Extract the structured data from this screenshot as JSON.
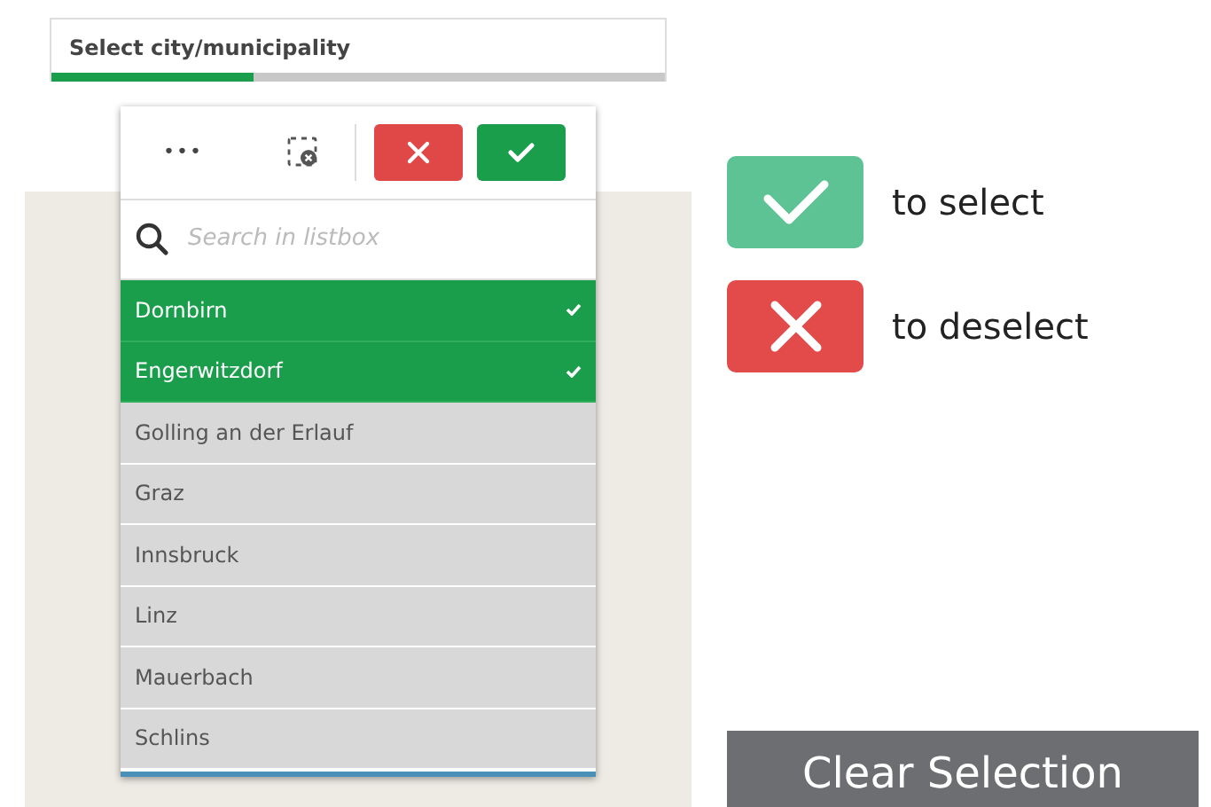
{
  "selector": {
    "title": "Select city/municipality",
    "level": 0.33
  },
  "toolbar": {
    "more": "•••"
  },
  "search": {
    "placeholder": "Search in listbox"
  },
  "items": [
    {
      "label": "Dornbirn",
      "selected": true
    },
    {
      "label": "Engerwitzdorf",
      "selected": true
    },
    {
      "label": "Golling an der Erlauf",
      "selected": false
    },
    {
      "label": "Graz",
      "selected": false
    },
    {
      "label": "Innsbruck",
      "selected": false
    },
    {
      "label": "Linz",
      "selected": false
    },
    {
      "label": "Mauerbach",
      "selected": false
    },
    {
      "label": "Schlins",
      "selected": false
    }
  ],
  "legend": [
    {
      "kind": "confirm",
      "text": "to select"
    },
    {
      "kind": "cancel",
      "text": "to deselect"
    }
  ],
  "clear_button": "Clear Selection"
}
